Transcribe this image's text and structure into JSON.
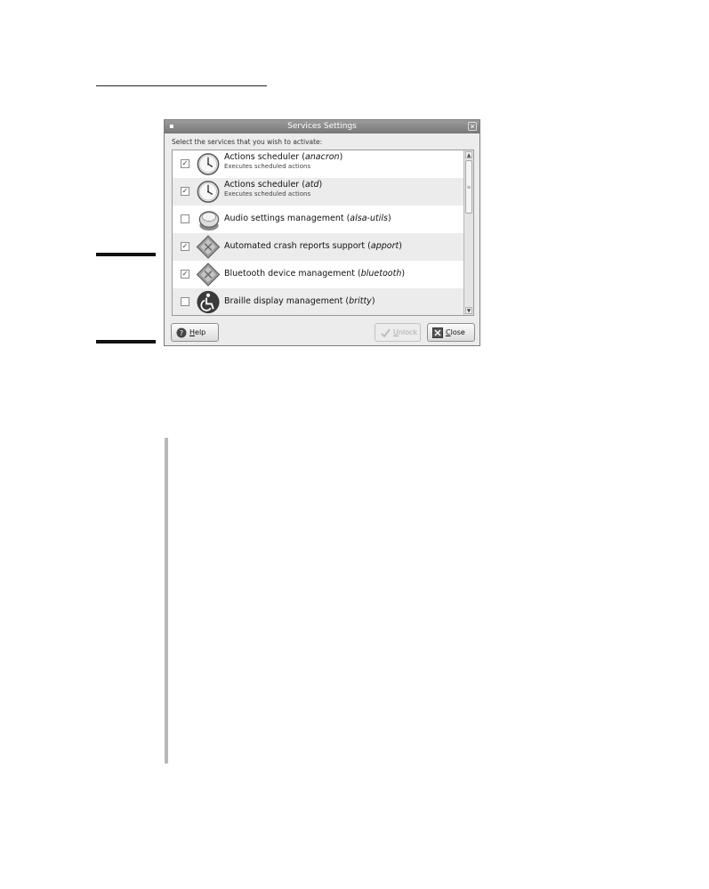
{
  "window": {
    "title": "Services Settings",
    "instruction": "Select the services that you wish to activate:"
  },
  "services": [
    {
      "title_prefix": "Actions scheduler (",
      "name": "anacron",
      "title_suffix": ")",
      "description": "Executes scheduled actions",
      "checked": true,
      "checkmark": "✓",
      "icon": "clock-icon"
    },
    {
      "title_prefix": "Actions scheduler (",
      "name": "atd",
      "title_suffix": ")",
      "description": "Executes scheduled actions",
      "checked": true,
      "checkmark": "✓",
      "icon": "clock-icon"
    },
    {
      "title_prefix": "Audio settings management (",
      "name": "alsa-utils",
      "title_suffix": ")",
      "description": "",
      "checked": false,
      "checkmark": "",
      "icon": "audio-device-icon"
    },
    {
      "title_prefix": "Automated crash reports support (",
      "name": "apport",
      "title_suffix": ")",
      "description": "",
      "checked": true,
      "checkmark": "✓",
      "icon": "service-diamond-icon"
    },
    {
      "title_prefix": "Bluetooth device management (",
      "name": "bluetooth",
      "title_suffix": ")",
      "description": "",
      "checked": true,
      "checkmark": "✓",
      "icon": "service-diamond-icon"
    },
    {
      "title_prefix": "Braille display management (",
      "name": "britty",
      "title_suffix": ")",
      "description": "",
      "checked": false,
      "checkmark": "",
      "icon": "accessibility-icon"
    }
  ],
  "buttons": {
    "help_mnemonic": "H",
    "help_rest": "elp",
    "unlock_mnemonic": "U",
    "unlock_rest": "nlock",
    "close_mnemonic": "C",
    "close_rest": "lose"
  },
  "titlebar": {
    "menu_glyph": "▪",
    "close_glyph": "✕"
  },
  "scrollbar": {
    "up_glyph": "▲",
    "down_glyph": "▼",
    "grip_glyph": "≡"
  }
}
